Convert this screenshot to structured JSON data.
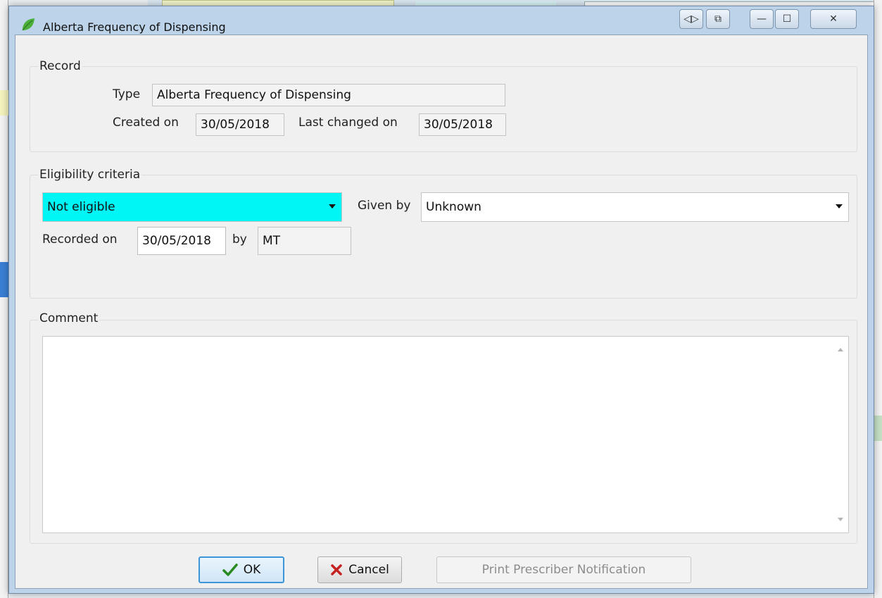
{
  "window": {
    "title": "Alberta Frequency of Dispensing",
    "controls": {
      "minimize": "—",
      "maximize": "☐",
      "close": "✕",
      "nav": "◁▷",
      "tile": "⧉"
    }
  },
  "record": {
    "legend": "Record",
    "type_label": "Type",
    "type_value": "Alberta Frequency of Dispensing",
    "created_label": "Created on",
    "created_value": "30/05/2018",
    "changed_label": "Last changed on",
    "changed_value": "30/05/2018"
  },
  "eligibility": {
    "legend": "Eligibility criteria",
    "status_value": "Not eligible",
    "status_color": "#00f5f5",
    "given_by_label": "Given by",
    "given_by_value": "Unknown",
    "recorded_label": "Recorded on",
    "recorded_value": "30/05/2018",
    "by_label": "by",
    "by_value": "MT"
  },
  "comment": {
    "legend": "Comment",
    "value": ""
  },
  "buttons": {
    "ok": "OK",
    "cancel": "Cancel",
    "print": "Print Prescriber Notification"
  },
  "icons": {
    "app": "leaf-icon",
    "ok": "checkmark-icon",
    "cancel": "x-icon"
  }
}
